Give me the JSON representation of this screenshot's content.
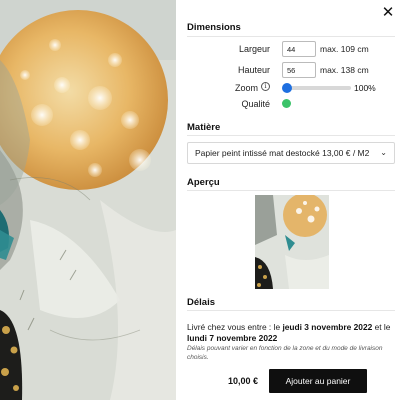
{
  "panel": {
    "close_label": "✕",
    "dimensions": {
      "title": "Dimensions",
      "width_label": "Largeur",
      "width_value": "44",
      "width_max": "max. 109 cm",
      "height_label": "Hauteur",
      "height_value": "56",
      "height_max": "max. 138 cm",
      "zoom_label": "Zoom",
      "zoom_info_icon": "info-icon",
      "zoom_level": 100,
      "zoom_value": "100%",
      "quality_label": "Qualité",
      "quality_color": "#3cc36a"
    },
    "material": {
      "title": "Matière",
      "selected": "Papier peint intissé mat destocké 13,00 € / M2",
      "chevron_icon": "chevron-down-icon"
    },
    "preview": {
      "title": "Aperçu"
    },
    "delays": {
      "title": "Délais",
      "intro": "Livré chez vous entre : le ",
      "date_start": "jeudi 3 novembre 2022",
      "connector": " et le ",
      "date_end": "lundi 7 novembre 2022",
      "note": "Délais pouvant varier en fonction de la zone et du mode de livraison choisis."
    },
    "price": "10,00 €",
    "add_to_cart_label": "Ajouter au panier",
    "accent_color": "#1e6fe0"
  }
}
